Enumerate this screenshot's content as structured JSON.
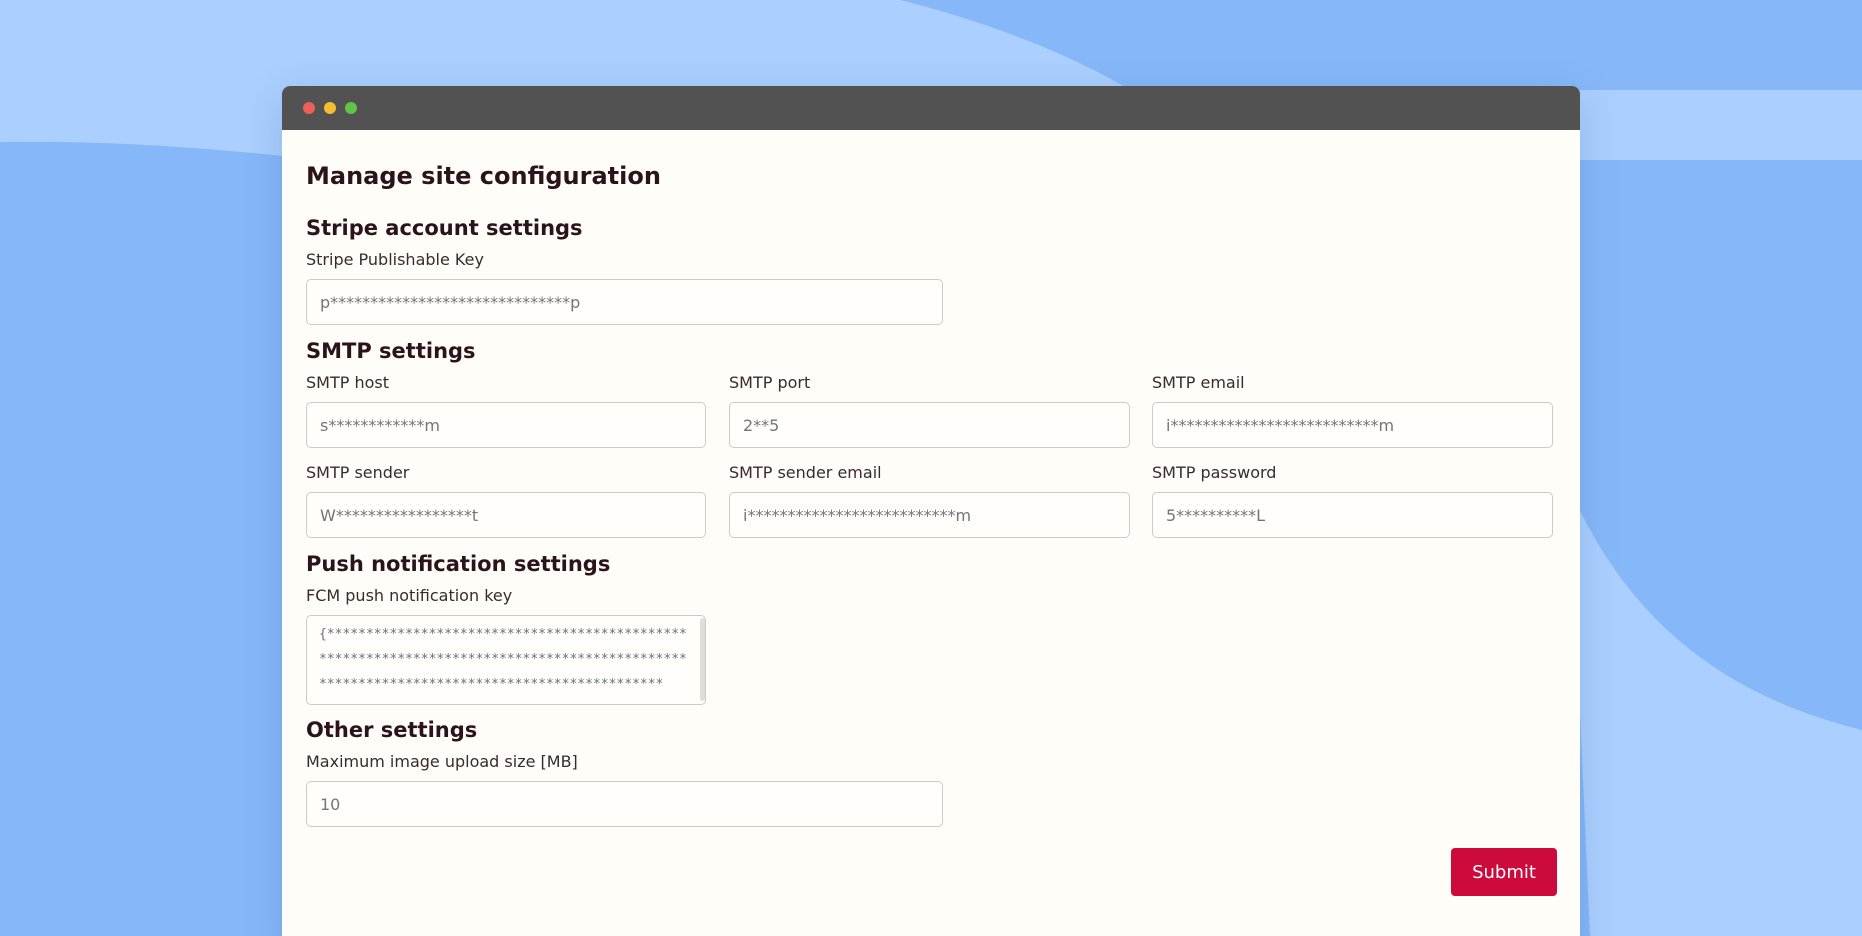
{
  "colors": {
    "background_light": "#abd0ff",
    "background_dark": "#86b8f9",
    "titlebar": "#525252",
    "panel": "#fefdf8",
    "submit": "#cd0a3c"
  },
  "page": {
    "title": "Manage site configuration"
  },
  "stripe": {
    "heading": "Stripe account settings",
    "publishable_key_label": "Stripe Publishable Key",
    "publishable_key_value": "p******************************p"
  },
  "smtp": {
    "heading": "SMTP settings",
    "host_label": "SMTP host",
    "host_value": "s************m",
    "port_label": "SMTP port",
    "port_value": "2**5",
    "email_label": "SMTP email",
    "email_value": "i**************************m",
    "sender_label": "SMTP sender",
    "sender_value": "W*****************t",
    "sender_email_label": "SMTP sender email",
    "sender_email_value": "i**************************m",
    "password_label": "SMTP password",
    "password_value": "5**********L"
  },
  "push": {
    "heading": "Push notification settings",
    "fcm_key_label": "FCM push notification key",
    "fcm_key_value": "{*****************************************************************************************************************************************"
  },
  "other": {
    "heading": "Other settings",
    "max_upload_label": "Maximum image upload size [MB]",
    "max_upload_value": "10"
  },
  "actions": {
    "submit_label": "Submit"
  }
}
